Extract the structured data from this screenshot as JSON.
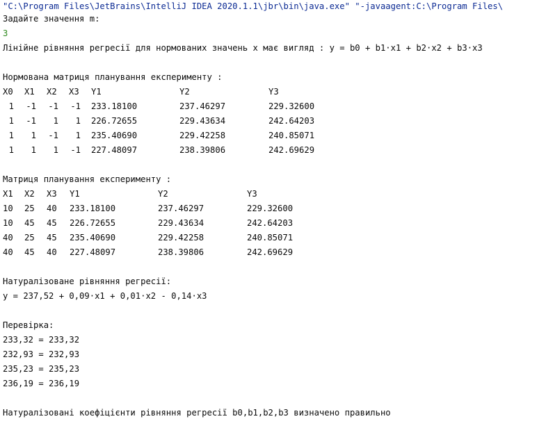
{
  "console": {
    "command": "\"C:\\Program Files\\JetBrains\\IntelliJ IDEA 2020.1.1\\jbr\\bin\\java.exe\" \"-javaagent:C:\\Program Files\\",
    "prompt": "Задайте значення m:",
    "user_input": "3",
    "equation_intro": "Лінійне рівняння регресії для нормованих значень x має вигляд : y = b0 + b1·x1 + b2·x2 + b3·x3",
    "normalized_title": "Нормована матриця планування експерименту :",
    "normalized_table": {
      "headers": [
        "X0",
        "X1",
        "X2",
        "X3",
        "Y1",
        "Y2",
        "Y3"
      ],
      "rows": [
        [
          "1",
          "-1",
          "-1",
          "-1",
          "233.18100",
          "237.46297",
          "229.32600"
        ],
        [
          "1",
          "-1",
          "1",
          "1",
          "226.72655",
          "229.43634",
          "242.64203"
        ],
        [
          "1",
          "1",
          "-1",
          "1",
          "235.40690",
          "229.42258",
          "240.85071"
        ],
        [
          "1",
          "1",
          "1",
          "-1",
          "227.48097",
          "238.39806",
          "242.69629"
        ]
      ]
    },
    "natural_title": "Матриця планування експерименту :",
    "natural_table": {
      "headers": [
        "X1",
        "X2",
        "X3",
        "Y1",
        "Y2",
        "Y3"
      ],
      "rows": [
        [
          "10",
          "25",
          "40",
          "233.18100",
          "237.46297",
          "229.32600"
        ],
        [
          "10",
          "45",
          "45",
          "226.72655",
          "229.43634",
          "242.64203"
        ],
        [
          "40",
          "25",
          "45",
          "235.40690",
          "229.42258",
          "240.85071"
        ],
        [
          "40",
          "45",
          "40",
          "227.48097",
          "238.39806",
          "242.69629"
        ]
      ]
    },
    "naturalized_title": "Натуралізоване рівняння регресії:",
    "naturalized_equation": "y = 237,52 + 0,09·x1 + 0,01·x2 - 0,14·x3",
    "check_title": "Перевірка:",
    "checks": [
      "233,32 = 233,32",
      "232,93 = 232,93",
      "235,23 = 235,23",
      "236,19 = 236,19"
    ],
    "conclusion": "Натуралізовані коефіцієнти рівняння регресії b0,b1,b2,b3 визначено правильно"
  }
}
